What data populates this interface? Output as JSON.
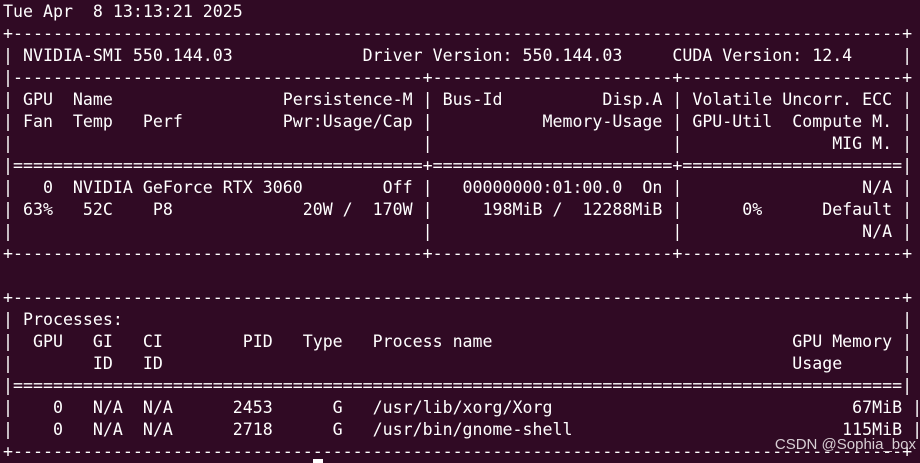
{
  "terminal": {
    "lines": [
      "Tue Apr  8 13:13:21 2025",
      "+-----------------------------------------------------------------------------------------+",
      "| NVIDIA-SMI 550.144.03             Driver Version: 550.144.03     CUDA Version: 12.4     |",
      "|-----------------------------------------+------------------------+----------------------+",
      "| GPU  Name                 Persistence-M | Bus-Id          Disp.A | Volatile Uncorr. ECC |",
      "| Fan  Temp   Perf          Pwr:Usage/Cap |           Memory-Usage | GPU-Util  Compute M. |",
      "|                                         |                        |               MIG M. |",
      "|=========================================+========================+======================|",
      "|   0  NVIDIA GeForce RTX 3060        Off |   00000000:01:00.0  On |                  N/A |",
      "| 63%   52C    P8             20W /  170W |     198MiB /  12288MiB |      0%      Default |",
      "|                                         |                        |                  N/A |",
      "+-----------------------------------------+------------------------+----------------------+",
      "",
      "+-----------------------------------------------------------------------------------------+",
      "| Processes:                                                                              |",
      "|  GPU   GI   CI        PID   Type   Process name                              GPU Memory |",
      "|        ID   ID                                                               Usage      |",
      "|=========================================================================================|",
      "|    0   N/A  N/A      2453      G   /usr/lib/xorg/Xorg                              67MiB |",
      "|    0   N/A  N/A      2718      G   /usr/bin/gnome-shell                           115MiB |",
      "+-----------------------------------------------------------------------------------------+"
    ]
  },
  "watermark": "CSDN @Sophia_box",
  "colors": {
    "background": "#300a24",
    "foreground": "#ffffff"
  }
}
